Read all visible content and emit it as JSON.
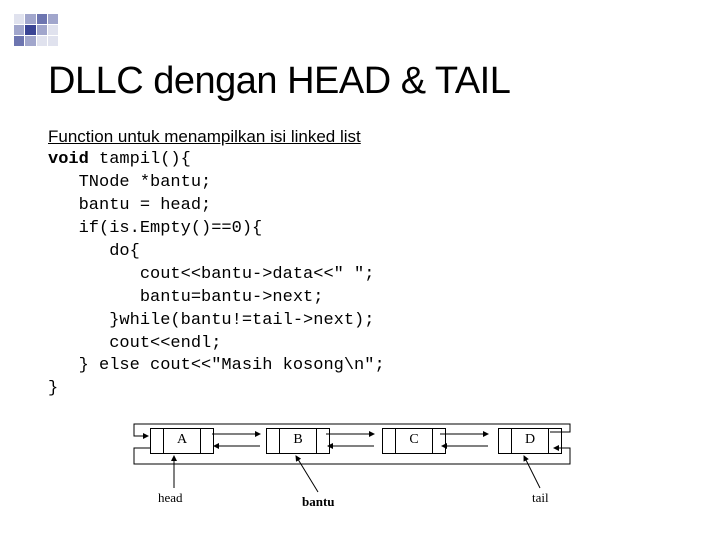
{
  "title": "DLLC dengan HEAD & TAIL",
  "subtitle": "Function untuk menampilkan isi linked list",
  "code": {
    "l1_kw": "void",
    "l1_rest": " tampil(){",
    "l2": "   TNode *bantu;",
    "l3": "   bantu = head;",
    "l4": "   if(is.Empty()==0){",
    "l5": "      do{",
    "l6": "         cout<<bantu->data<<\" \";",
    "l7": "         bantu=bantu->next;",
    "l8": "      }while(bantu!=tail->next);",
    "l9": "      cout<<endl;",
    "l10": "   } else cout<<\"Masih kosong\\n\";",
    "l11": "}"
  },
  "diagram": {
    "nodes": [
      "A",
      "B",
      "C",
      "D"
    ],
    "labels": {
      "head": "head",
      "bantu": "bantu",
      "tail": "tail"
    }
  }
}
